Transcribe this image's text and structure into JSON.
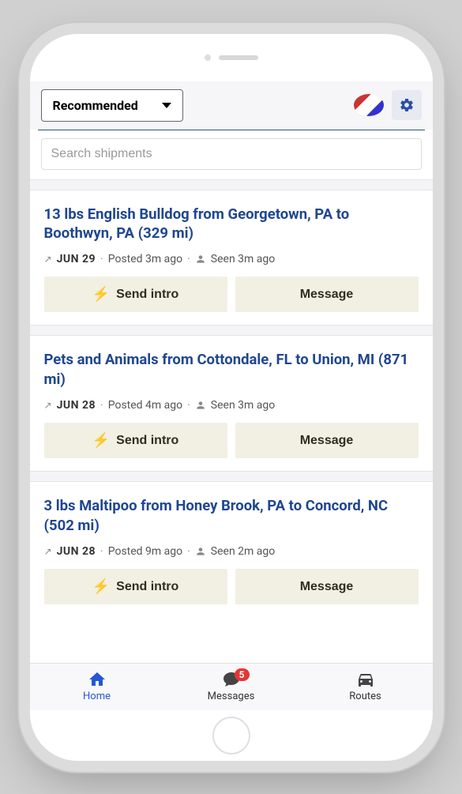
{
  "topbar": {
    "dropdown_label": "Recommended"
  },
  "search": {
    "placeholder": "Search shipments"
  },
  "listings": [
    {
      "title": "13 lbs English Bulldog from Georgetown, PA to Boothwyn, PA (329 mi)",
      "date": "JUN 29",
      "posted": "Posted 3m ago",
      "seen": "Seen 3m ago",
      "intro_label": "Send intro",
      "message_label": "Message"
    },
    {
      "title": "Pets and Animals from Cottondale, FL to Union, MI (871 mi)",
      "date": "JUN 28",
      "posted": "Posted 4m ago",
      "seen": "Seen 3m ago",
      "intro_label": "Send intro",
      "message_label": "Message"
    },
    {
      "title": "3 lbs Maltipoo from Honey Brook, PA to Concord, NC (502 mi)",
      "date": "JUN 28",
      "posted": "Posted 9m ago",
      "seen": "Seen 2m ago",
      "intro_label": "Send intro",
      "message_label": "Message"
    }
  ],
  "nav": {
    "home": "Home",
    "messages": "Messages",
    "routes": "Routes",
    "badge": "5"
  }
}
